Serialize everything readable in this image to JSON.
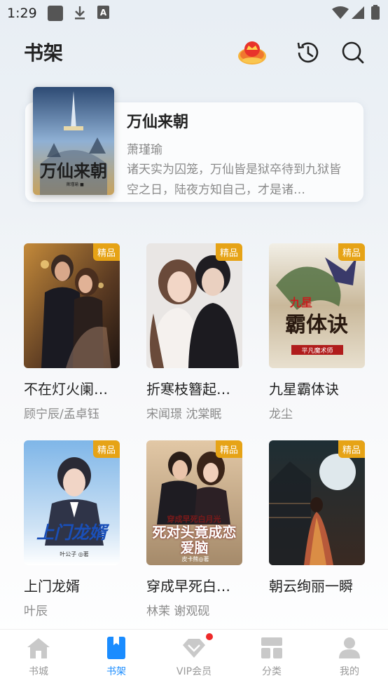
{
  "status_bar": {
    "time": "1:29"
  },
  "header": {
    "title": "书架"
  },
  "featured": {
    "title": "万仙来朝",
    "author": "萧瑾瑜",
    "description": "诸天实为囚笼，万仙皆是狱卒待到九狱皆空之日，陆夜方知自己，才是诸…",
    "cover_text": "万仙来朝",
    "cover_author": "萧瑾瑜 ■"
  },
  "books": [
    {
      "title": "不在灯火阑…",
      "author": "顾宁辰/孟卓钰",
      "badge": "精品"
    },
    {
      "title": "折寒枝簪起…",
      "author": "宋闻璟  沈棠眠",
      "badge": "精品"
    },
    {
      "title": "九星霸体诀",
      "author": "龙尘",
      "badge": "精品",
      "cover_text": "霸体诀",
      "cover_sub": "平凡魔术师",
      "cover_top": "九星"
    },
    {
      "title": "上门龙婿",
      "author": "叶辰",
      "badge": "精品",
      "cover_text": "上门龙婿",
      "cover_sub": "叶公子 ◎著"
    },
    {
      "title": "穿成早死白…",
      "author": "林茉  谢观砚",
      "badge": "精品",
      "cover_top": "穿成早死白月光",
      "cover_text": "死对头竟成恋爱脑",
      "cover_sub": "皮卡熊◎著"
    },
    {
      "title": "朝云绚丽一瞬",
      "author": "",
      "badge": "精品"
    }
  ],
  "nav": [
    {
      "label": "书城"
    },
    {
      "label": "书架"
    },
    {
      "label": "VIP会员"
    },
    {
      "label": "分类"
    },
    {
      "label": "我的"
    }
  ],
  "colors": {
    "accent": "#1a8cff",
    "badge": "#e6a316",
    "inactive": "#c9c9c9"
  }
}
